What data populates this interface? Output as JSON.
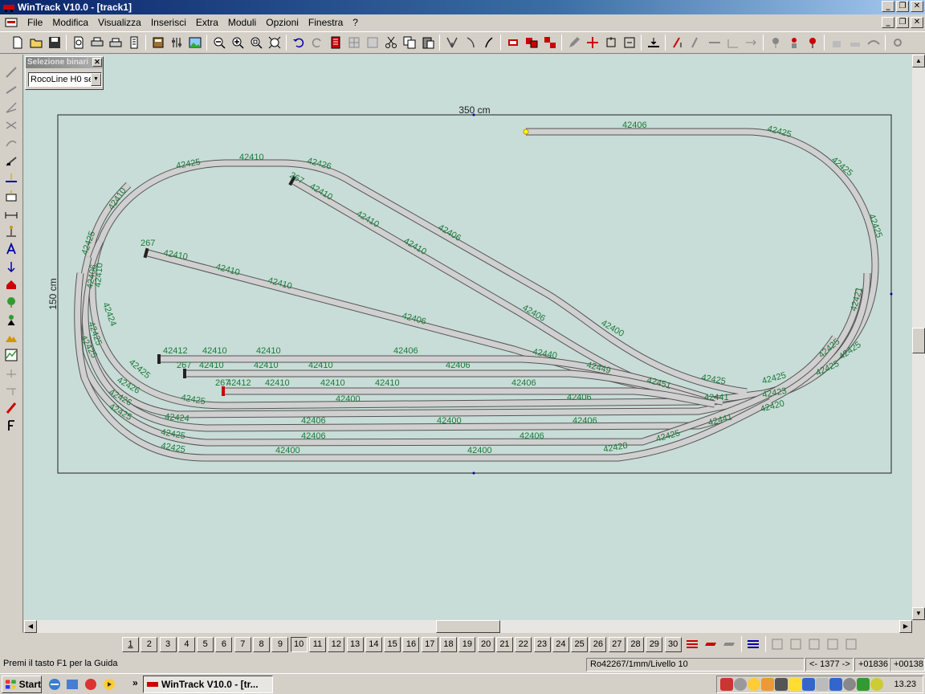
{
  "window": {
    "title": "WinTrack  V10.0 - [track1]",
    "controls": [
      "_",
      "❐",
      "✕"
    ]
  },
  "menu": {
    "items": [
      "File",
      "Modifica",
      "Visualizza",
      "Inserisci",
      "Extra",
      "Moduli",
      "Opzioni",
      "Finestra",
      "?"
    ]
  },
  "selection_panel": {
    "title": "Selezione binari",
    "value": "RocoLine H0 se"
  },
  "dimensions": {
    "width": "350 cm",
    "height": "150 cm"
  },
  "track_labels": [
    "42406",
    "42425",
    "42425",
    "42425",
    "42421",
    "42425",
    "42425",
    "42425",
    "42423",
    "42420",
    "42425",
    "42410",
    "42426",
    "267",
    "42410",
    "42410",
    "42410",
    "42406",
    "42410",
    "42406",
    "42400",
    "42406",
    "267",
    "42410",
    "42410",
    "42410",
    "42406",
    "42440",
    "42449",
    "42451",
    "42425",
    "42410",
    "42424",
    "42425",
    "42425",
    "42426",
    "42426",
    "42425",
    "42425",
    "42441",
    "42412",
    "42410",
    "42410",
    "42406",
    "267",
    "42410",
    "42410",
    "42410",
    "42406",
    "267",
    "42412",
    "42410",
    "42410",
    "42410",
    "42406",
    "42400",
    "42406",
    "42424",
    "42406",
    "42400",
    "42406",
    "42441",
    "42425",
    "42406",
    "42406",
    "42425",
    "42425",
    "42400",
    "42400",
    "42420",
    "42425",
    "42425",
    "42425"
  ],
  "layers": {
    "buttons": [
      "1",
      "2",
      "3",
      "4",
      "5",
      "6",
      "7",
      "8",
      "9",
      "10",
      "11",
      "12",
      "13",
      "14",
      "15",
      "16",
      "17",
      "18",
      "19",
      "20",
      "21",
      "22",
      "23",
      "24",
      "25",
      "26",
      "27",
      "28",
      "29",
      "30"
    ],
    "selected": "10"
  },
  "status": {
    "help": "Premi il tasto F1 per la Guida",
    "info": "Ro42267/1mm/Livello 10",
    "angle": "<- 1377 ->",
    "x": "+01836",
    "y": "+00138"
  },
  "taskbar": {
    "start": "Start",
    "task": "WinTrack  V10.0 - [tr...",
    "clock": "13.23"
  },
  "colors": {
    "canvas": "#c8ddd7",
    "track_fill": "#d0d0d0",
    "track_label": "#1a7a3a",
    "title_start": "#0a246a"
  }
}
